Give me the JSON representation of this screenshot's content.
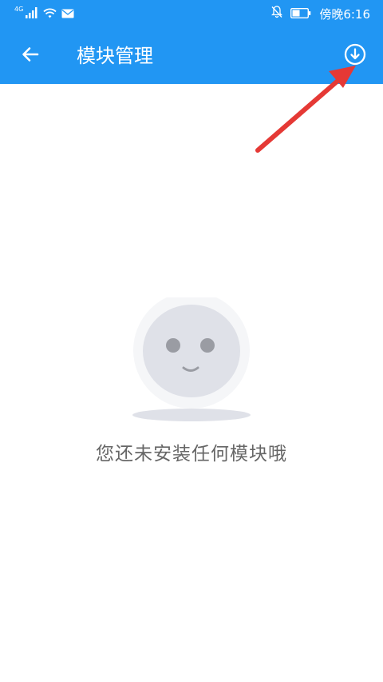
{
  "status_bar": {
    "network_label": "4G",
    "time": "傍晚6:16",
    "icons": [
      "signal-icon",
      "wifi-icon",
      "mail-icon",
      "notifications-off-icon",
      "battery-icon"
    ]
  },
  "app_bar": {
    "title": "模块管理",
    "back_icon": "arrow-left-icon",
    "action_icon": "download-icon"
  },
  "empty_state": {
    "message": "您还未安装任何模块哦",
    "illustration": "smiley-face"
  },
  "annotation": {
    "arrow_color": "#e53935"
  },
  "colors": {
    "accent": "#2196f3",
    "text_secondary": "#666666"
  }
}
